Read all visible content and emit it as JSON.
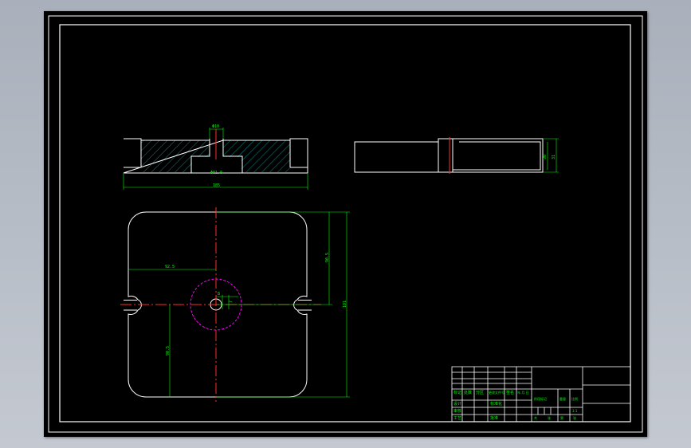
{
  "colors": {
    "background": "#000000",
    "outline": "#ffffff",
    "dimension": "#00ff00",
    "centerline": "#ff2a2a",
    "circle": "#ff00ff",
    "hatch": "#00a8a8"
  },
  "front_view": {
    "dim_top": "Φ10",
    "dim_bore": "Φ81.6",
    "dim_width": "185"
  },
  "side_view": {
    "dim_inner": "30",
    "dim_outer": "31"
  },
  "plan_view": {
    "dim_half_width": "92.5",
    "dim_hole": "8",
    "dim_hole_offset": "7",
    "dim_half_height": "90.5",
    "dim_height": "181",
    "dim_lower": "90.5"
  },
  "title_block": {
    "row1": [
      "标记",
      "处数",
      "分区",
      "更改文件号",
      "签名",
      "年.月.日"
    ],
    "row2": [
      "设计",
      "",
      "",
      "标准化",
      ""
    ],
    "row3": [
      "审核",
      "",
      "",
      "",
      "",
      ""
    ],
    "row4": [
      "工艺",
      "",
      "",
      "批准",
      ""
    ],
    "stage_label": "阶段标记",
    "weight_label": "重量",
    "scale_label": "比例",
    "scale_value": "1:1",
    "sheet_info": [
      "共",
      "张",
      "第",
      "张"
    ]
  }
}
